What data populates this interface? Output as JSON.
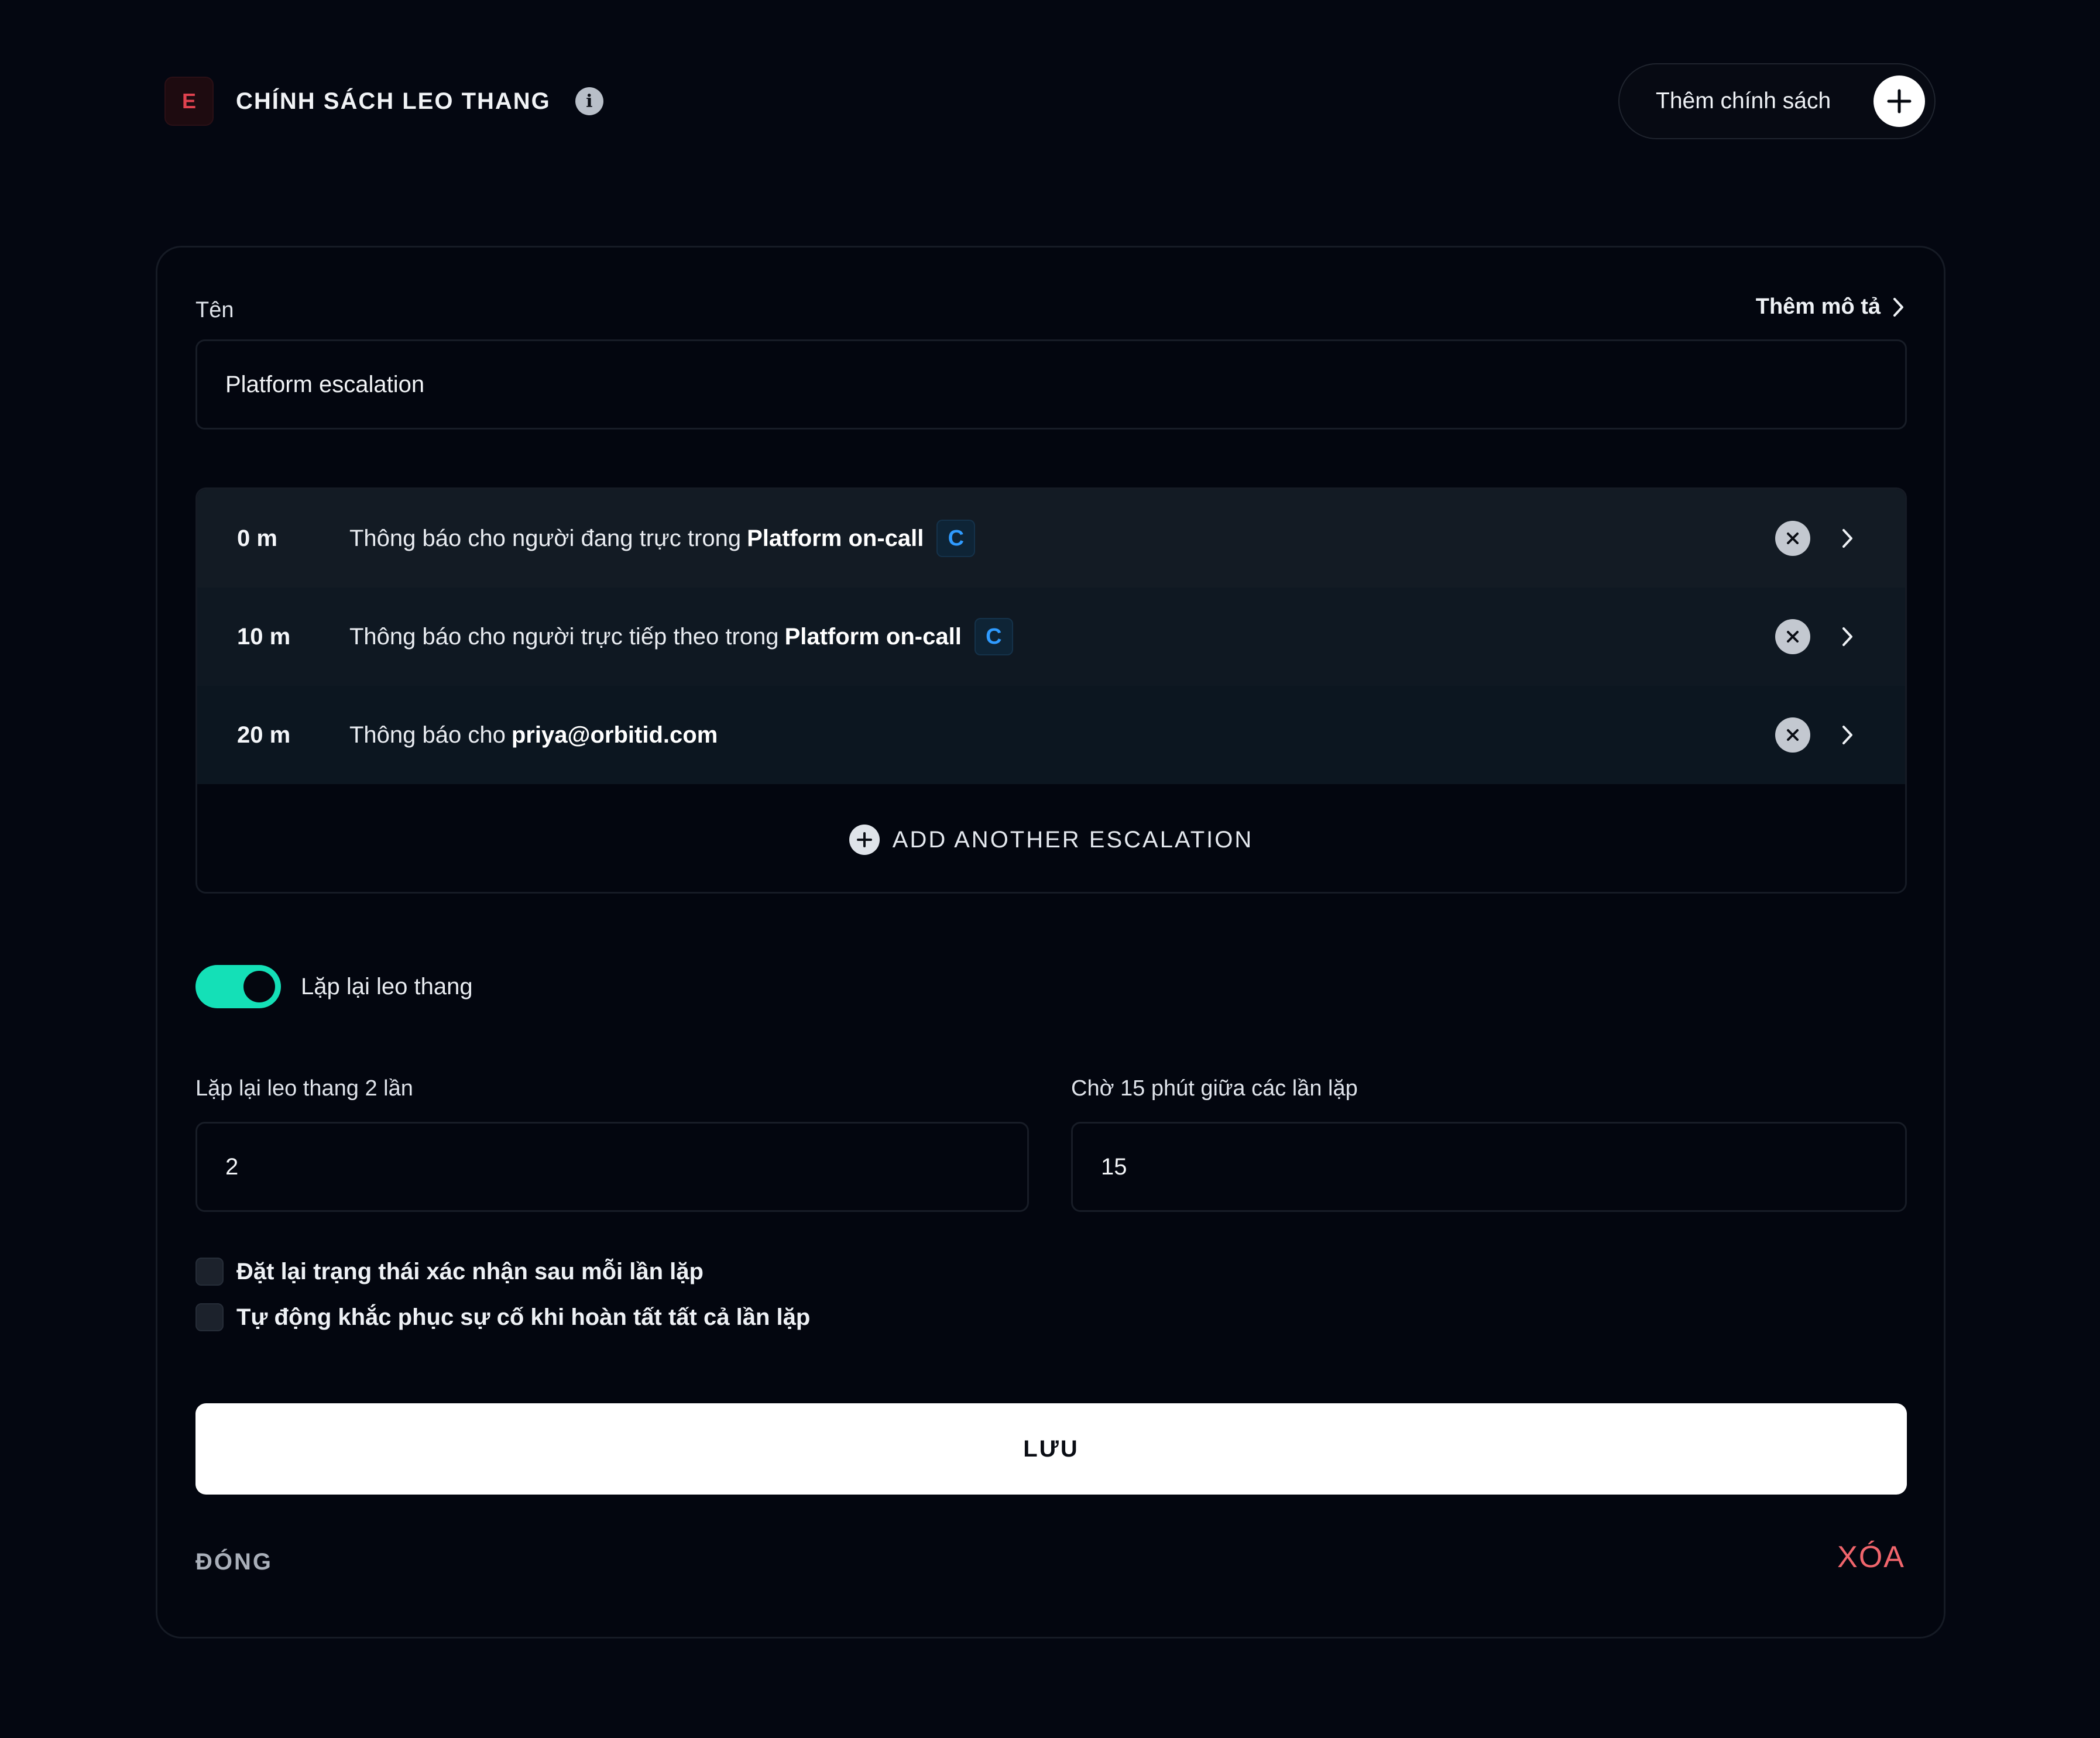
{
  "header": {
    "logo_letter": "E",
    "title": "CHÍNH SÁCH LEO THANG",
    "add_policy_label": "Thêm chính sách"
  },
  "form": {
    "name_label": "Tên",
    "add_description_label": "Thêm mô tả",
    "name_value": "Platform escalation",
    "escalations": [
      {
        "time": "0 m",
        "text": "Thông báo cho người đang trực trong",
        "target": "Platform on-call",
        "badge": "C"
      },
      {
        "time": "10 m",
        "text": "Thông báo cho người trực tiếp theo trong",
        "target": "Platform on-call",
        "badge": "C"
      },
      {
        "time": "20 m",
        "text": "Thông báo cho",
        "target": "priya@orbitid.com"
      }
    ],
    "add_escalation_label": "ADD ANOTHER ESCALATION",
    "repeat_toggle_label": "Lặp lại leo thang",
    "repeat_toggle_on": true,
    "repeat_count_label": "Lặp lại leo thang 2 lần",
    "repeat_count_value": "2",
    "wait_label": "Chờ 15 phút giữa các lần lặp",
    "wait_value": "15",
    "checkboxes": [
      {
        "label": "Đặt lại trạng thái xác nhận sau mỗi lần lặp",
        "checked": false
      },
      {
        "label": "Tự động khắc phục sự cố khi hoàn tất tất cả lần lặp",
        "checked": false
      }
    ],
    "save_label": "LƯU",
    "close_label": "ĐÓNG",
    "delete_label": "XÓA"
  },
  "colors": {
    "background": "#040711",
    "accent_toggle": "#14e0b7",
    "badge_blue": "#2f9bff",
    "logo_red": "#e0424f",
    "delete_red": "#f0656c"
  },
  "icons": [
    "info-icon",
    "plus-icon",
    "chevron-right-icon",
    "close-circle-icon",
    "plus-circle-icon"
  ]
}
